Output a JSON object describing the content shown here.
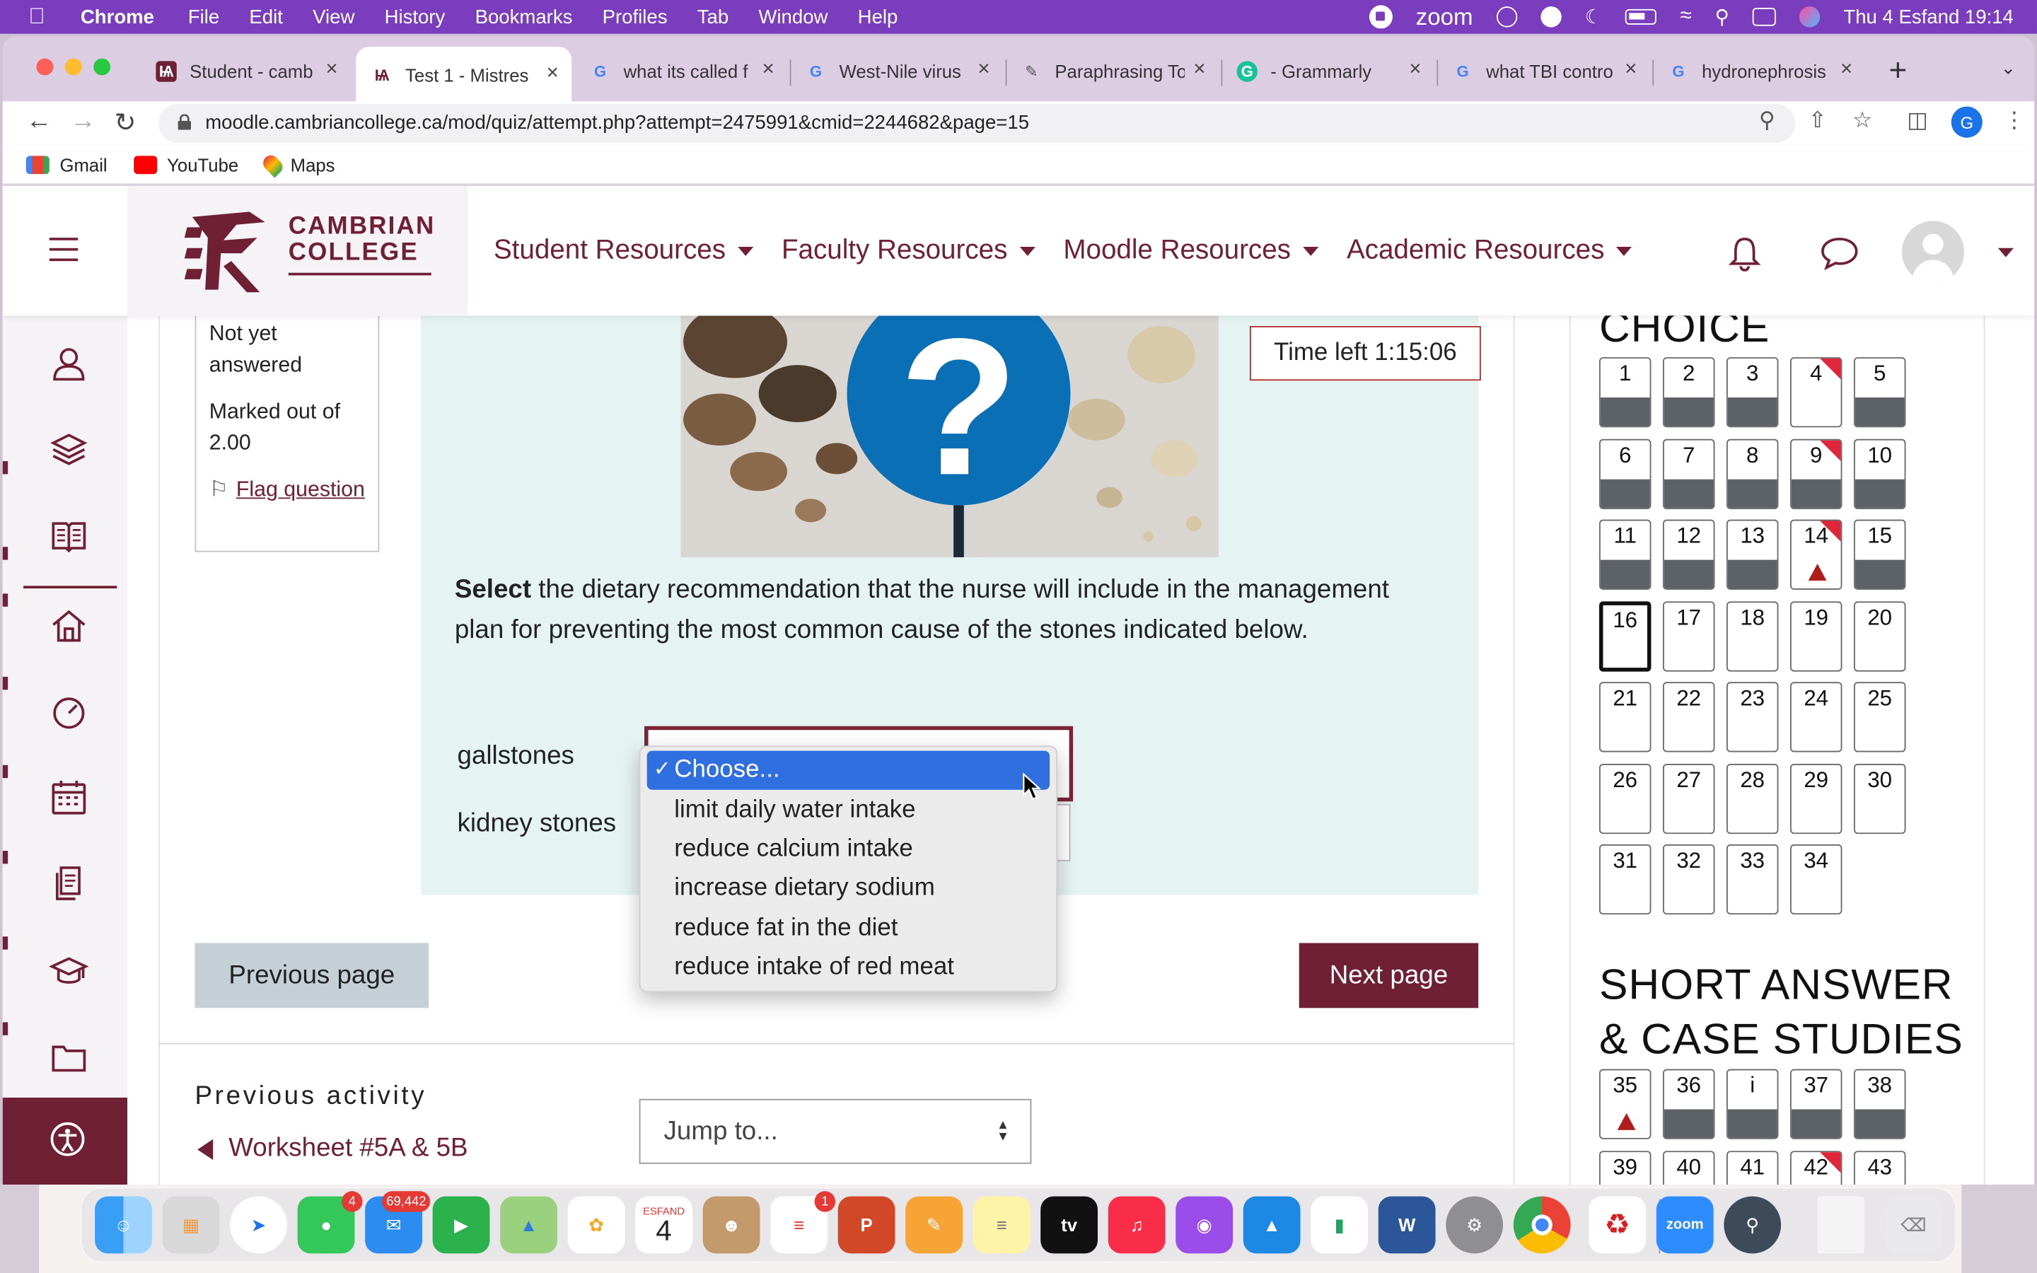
{
  "menubar": {
    "app": "Chrome",
    "items": [
      "File",
      "Edit",
      "View",
      "History",
      "Bookmarks",
      "Profiles",
      "Tab",
      "Window",
      "Help"
    ],
    "zoom": "zoom",
    "clock": "Thu 4 Esfand  19:14"
  },
  "tabs": [
    {
      "title": "Student - camb",
      "icon": "cambrian-favicon"
    },
    {
      "title": "Test 1 - Mistres",
      "icon": "cambrian-favicon",
      "active": true
    },
    {
      "title": "what its called f",
      "icon": "google-favicon"
    },
    {
      "title": "West-Nile virus",
      "icon": "google-favicon"
    },
    {
      "title": "Paraphrasing To",
      "icon": "quillbot-favicon"
    },
    {
      "title": "- Grammarly",
      "icon": "grammarly-favicon"
    },
    {
      "title": "what TBI contro",
      "icon": "google-favicon"
    },
    {
      "title": "hydronephrosis",
      "icon": "google-favicon"
    }
  ],
  "address": {
    "url": "moodle.cambriancollege.ca/mod/quiz/attempt.php?attempt=2475991&cmid=2244682&page=15",
    "profile_initial": "G"
  },
  "bookmarks": [
    "Gmail",
    "YouTube",
    "Maps"
  ],
  "site": {
    "logo_line1": "CAMBRIAN",
    "logo_line2": "COLLEGE",
    "nav": [
      "Student Resources",
      "Faculty Resources",
      "Moodle Resources",
      "Academic Resources"
    ]
  },
  "qinfo": {
    "status": "Not yet answered",
    "marks": "Marked out of 2.00",
    "flag": "Flag question"
  },
  "question": {
    "timer": "Time left 1:15:06",
    "text_bold": "Select",
    "text_rest": " the dietary recommendation that the nurse will include in the management plan for preventing the most common cause of the stones indicated below.",
    "row1_label": "gallstones",
    "row2_label": "kidney stones",
    "options": [
      "Choose...",
      "limit daily water intake",
      "reduce calcium intake",
      "increase dietary sodium",
      "reduce fat in the diet",
      "reduce intake of red meat"
    ],
    "selected_index": 0
  },
  "nav_buttons": {
    "prev": "Previous page",
    "next": "Next page"
  },
  "activity": {
    "heading": "Previous activity",
    "link": "Worksheet #5A & 5B",
    "jump_placeholder": "Jump to..."
  },
  "quiz_nav": {
    "section1_heading": "CHOICE",
    "section2_heading": "SHORT ANSWER & CASE STUDIES",
    "section1": [
      {
        "n": "1",
        "answered": true
      },
      {
        "n": "2",
        "answered": true
      },
      {
        "n": "3",
        "answered": true
      },
      {
        "n": "4",
        "flagged": true
      },
      {
        "n": "5",
        "answered": true
      },
      {
        "n": "6",
        "answered": true
      },
      {
        "n": "7",
        "answered": true
      },
      {
        "n": "8",
        "answered": true
      },
      {
        "n": "9",
        "answered": true,
        "flagged": true
      },
      {
        "n": "10",
        "answered": true
      },
      {
        "n": "11",
        "answered": true
      },
      {
        "n": "12",
        "answered": true
      },
      {
        "n": "13",
        "answered": true
      },
      {
        "n": "14",
        "flagged": true,
        "warning": true
      },
      {
        "n": "15",
        "answered": true
      },
      {
        "n": "16",
        "current": true
      },
      {
        "n": "17"
      },
      {
        "n": "18"
      },
      {
        "n": "19"
      },
      {
        "n": "20"
      },
      {
        "n": "21"
      },
      {
        "n": "22"
      },
      {
        "n": "23"
      },
      {
        "n": "24"
      },
      {
        "n": "25"
      },
      {
        "n": "26"
      },
      {
        "n": "27"
      },
      {
        "n": "28"
      },
      {
        "n": "29"
      },
      {
        "n": "30"
      },
      {
        "n": "31"
      },
      {
        "n": "32"
      },
      {
        "n": "33"
      },
      {
        "n": "34"
      }
    ],
    "section2": [
      {
        "n": "35",
        "warning": true
      },
      {
        "n": "36",
        "answered": true
      },
      {
        "n": "i",
        "answered": true
      },
      {
        "n": "37",
        "answered": true
      },
      {
        "n": "38",
        "answered": true
      },
      {
        "n": "39"
      },
      {
        "n": "40"
      },
      {
        "n": "41"
      },
      {
        "n": "42",
        "flagged": true
      },
      {
        "n": "43"
      }
    ]
  },
  "dock": {
    "messages_badge": "4",
    "mail_badge": "69,442",
    "calendar_month": "ESFAND",
    "calendar_day": "4",
    "reminders_badge": "1"
  },
  "colors": {
    "brand": "#6f2034",
    "menubar": "#7a3dbd",
    "select_blue": "#2f6fe0",
    "question_bg": "#e6f3f3"
  }
}
